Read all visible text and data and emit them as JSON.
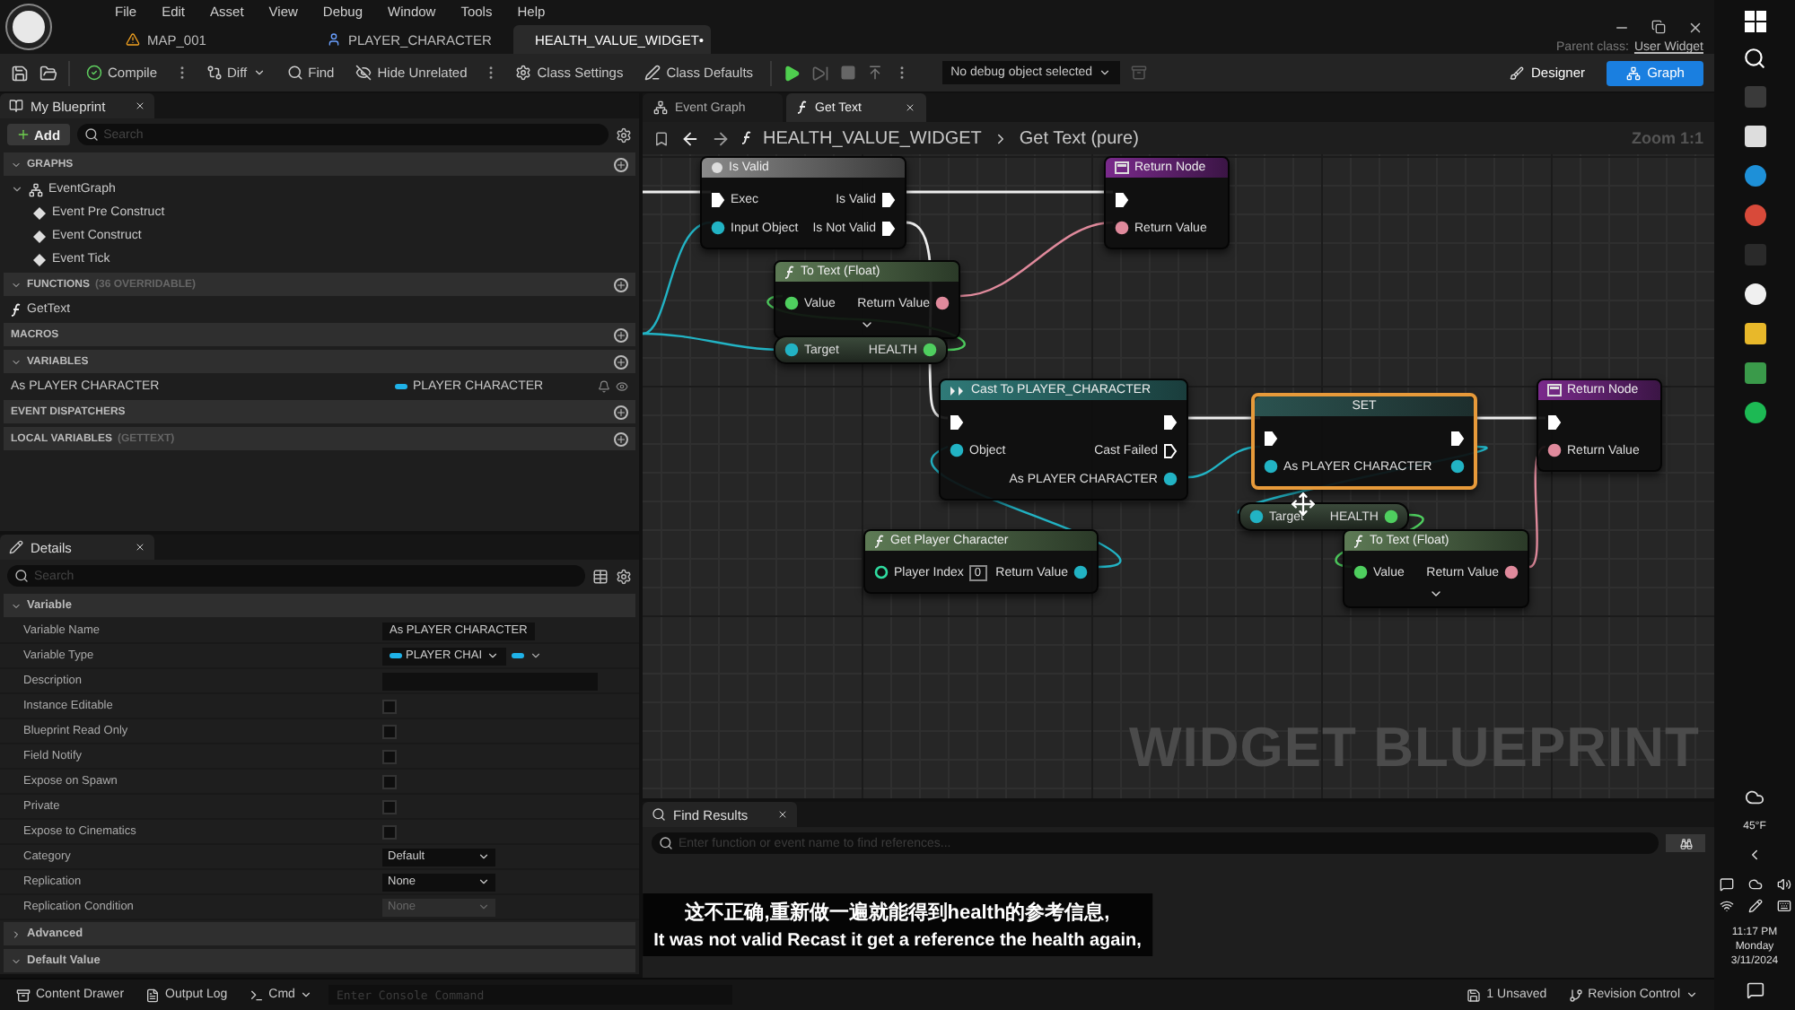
{
  "menu": [
    "File",
    "Edit",
    "Asset",
    "View",
    "Debug",
    "Window",
    "Tools",
    "Help"
  ],
  "doc_tabs": [
    {
      "label": "MAP_001",
      "kind": "map",
      "selected": false
    },
    {
      "label": "PLAYER_CHARACTER",
      "kind": "character",
      "selected": false
    },
    {
      "label": "HEALTH_VALUE_WIDGET•",
      "kind": "widget",
      "selected": true
    }
  ],
  "parent_class": {
    "label": "Parent class:",
    "value": "User Widget"
  },
  "toolbar": {
    "buttons": [
      {
        "label": "Compile",
        "kind": "compile"
      },
      {
        "label": "Diff",
        "kind": "diff"
      },
      {
        "label": "Find",
        "kind": "find"
      },
      {
        "label": "Hide Unrelated",
        "kind": "hide"
      },
      {
        "label": "Class Settings",
        "kind": "settings"
      },
      {
        "label": "Class Defaults",
        "kind": "defaults"
      }
    ],
    "debug": "No debug object selected",
    "modes": [
      {
        "label": "Designer",
        "selected": false
      },
      {
        "label": "Graph",
        "selected": true
      }
    ]
  },
  "my_blueprint": {
    "title": "My Blueprint",
    "add": "Add",
    "search_placeholder": "Search",
    "sections": [
      {
        "title": "GRAPHS",
        "items": [
          {
            "label": "EventGraph",
            "kind": "graph",
            "children": [
              {
                "label": "Event Pre Construct",
                "kind": "event"
              },
              {
                "label": "Event Construct",
                "kind": "event"
              },
              {
                "label": "Event Tick",
                "kind": "event"
              }
            ]
          }
        ]
      },
      {
        "title": "FUNCTIONS",
        "note": "(36 OVERRIDABLE)",
        "items": [
          {
            "label": "GetText",
            "kind": "function"
          }
        ]
      },
      {
        "title": "MACROS"
      },
      {
        "title": "VARIABLES",
        "items": [
          {
            "label": "As PLAYER CHARACTER",
            "kind": "variable",
            "type": "PLAYER CHARACTER"
          }
        ]
      },
      {
        "title": "EVENT DISPATCHERS"
      },
      {
        "title": "LOCAL VARIABLES",
        "note": "(GETTEXT)"
      }
    ]
  },
  "details": {
    "title": "Details",
    "search_placeholder": "Search",
    "sections": [
      {
        "title": "Variable",
        "expanded": true,
        "rows": [
          {
            "label": "Variable Name",
            "kind": "text",
            "value": "As PLAYER CHARACTER"
          },
          {
            "label": "Variable Type",
            "kind": "type",
            "value": "PLAYER CHAI"
          },
          {
            "label": "Description",
            "kind": "field"
          },
          {
            "label": "Instance Editable",
            "kind": "checkbox",
            "checked": false
          },
          {
            "label": "Blueprint Read Only",
            "kind": "checkbox",
            "checked": false
          },
          {
            "label": "Field Notify",
            "kind": "checkbox",
            "checked": false
          },
          {
            "label": "Expose on Spawn",
            "kind": "checkbox",
            "checked": false
          },
          {
            "label": "Private",
            "kind": "checkbox",
            "checked": false
          },
          {
            "label": "Expose to Cinematics",
            "kind": "checkbox",
            "checked": false
          },
          {
            "label": "Category",
            "kind": "combo",
            "value": "Default"
          },
          {
            "label": "Replication",
            "kind": "select",
            "value": "None",
            "disabled": false
          },
          {
            "label": "Replication Condition",
            "kind": "select",
            "value": "None",
            "disabled": true
          }
        ]
      },
      {
        "title": "Advanced",
        "expanded": false
      },
      {
        "title": "Default Value",
        "expanded": true
      }
    ]
  },
  "graph": {
    "tabs": [
      {
        "label": "Event Graph",
        "kind": "graph",
        "selected": false
      },
      {
        "label": "Get Text",
        "kind": "function",
        "selected": true
      }
    ],
    "breadcrumb": [
      "HEALTH_VALUE_WIDGET",
      "Get Text (pure)"
    ],
    "zoom": "Zoom 1:1",
    "watermark": "WIDGET BLUEPRINT",
    "nodes": [
      {
        "kind": "isvalid",
        "title": "Is Valid",
        "selected": false,
        "advanced": false,
        "rows": [
          {
            "left": {
              "kind": "exec",
              "label": "Exec"
            },
            "right": {
              "kind": "exec",
              "label": "Is Valid"
            }
          },
          {
            "left": {
              "kind": "object",
              "label": "Input Object"
            },
            "right": {
              "kind": "exec",
              "label": "Is Not Valid"
            }
          }
        ]
      },
      {
        "kind": "return",
        "title": "Return Node",
        "selected": false,
        "advanced": false,
        "rows": [
          {
            "left": {
              "kind": "exec"
            }
          },
          {
            "left": {
              "kind": "text",
              "label": "Return Value"
            }
          }
        ]
      },
      {
        "kind": "function",
        "title": "To Text (Float)",
        "selected": false,
        "advanced": true,
        "rows": [
          {
            "left": {
              "kind": "float",
              "label": "Value"
            },
            "right": {
              "kind": "text",
              "label": "Return Value"
            }
          }
        ]
      },
      {
        "kind": "getter",
        "selected": false,
        "advanced": false,
        "rows": [
          {
            "left": {
              "kind": "object",
              "label": "Target"
            },
            "right": {
              "kind": "float",
              "label": "HEALTH"
            }
          }
        ]
      },
      {
        "kind": "cast",
        "title": "Cast To PLAYER_CHARACTER",
        "selected": false,
        "advanced": false,
        "rows": [
          {
            "left": {
              "kind": "exec"
            },
            "right": {
              "kind": "exec"
            }
          },
          {
            "left": {
              "kind": "object",
              "label": "Object"
            },
            "right": {
              "kind": "hollow",
              "label": "Cast Failed"
            }
          },
          {
            "right": {
              "kind": "object",
              "label": "As PLAYER CHARACTER"
            }
          }
        ]
      },
      {
        "kind": "set",
        "title": "SET",
        "selected": true,
        "advanced": false,
        "rows": [
          {
            "left": {
              "kind": "exec"
            },
            "right": {
              "kind": "exec"
            }
          },
          {
            "left": {
              "kind": "object",
              "label": "As PLAYER CHARACTER"
            },
            "right": {
              "kind": "object"
            }
          }
        ]
      },
      {
        "kind": "return",
        "title": "Return Node",
        "selected": false,
        "advanced": false,
        "rows": [
          {
            "left": {
              "kind": "exec"
            }
          },
          {
            "left": {
              "kind": "text",
              "label": "Return Value"
            }
          }
        ]
      },
      {
        "kind": "getter",
        "selected": false,
        "advanced": false,
        "rows": [
          {
            "left": {
              "kind": "object",
              "label": "Target"
            },
            "right": {
              "kind": "float",
              "label": "HEALTH"
            }
          }
        ]
      },
      {
        "kind": "function",
        "title": "Get Player Character",
        "selected": false,
        "advanced": false,
        "rows": [
          {
            "left": {
              "kind": "int",
              "label": "Player Index",
              "value": "0"
            },
            "right": {
              "kind": "object",
              "label": "Return Value"
            }
          }
        ]
      },
      {
        "kind": "function",
        "title": "To Text (Float)",
        "selected": false,
        "advanced": true,
        "rows": [
          {
            "left": {
              "kind": "float",
              "label": "Value"
            },
            "right": {
              "kind": "text",
              "label": "Return Value"
            }
          }
        ]
      }
    ]
  },
  "find_results": {
    "title": "Find Results",
    "placeholder": "Enter function or event name to find references..."
  },
  "subtitles": [
    "这不正确,重新做一遍就能得到health的参考信息,",
    "It was not valid Recast it get a reference the health again,"
  ],
  "status_bar": {
    "content_drawer": "Content Drawer",
    "output_log": "Output Log",
    "cmd": "Cmd",
    "console_placeholder": "Enter Console Command",
    "unsaved": "1 Unsaved",
    "revision": "Revision Control"
  },
  "taskbar": {
    "weather": "45°F",
    "time": "11:17 PM",
    "day": "Monday",
    "date": "3/11/2024"
  }
}
